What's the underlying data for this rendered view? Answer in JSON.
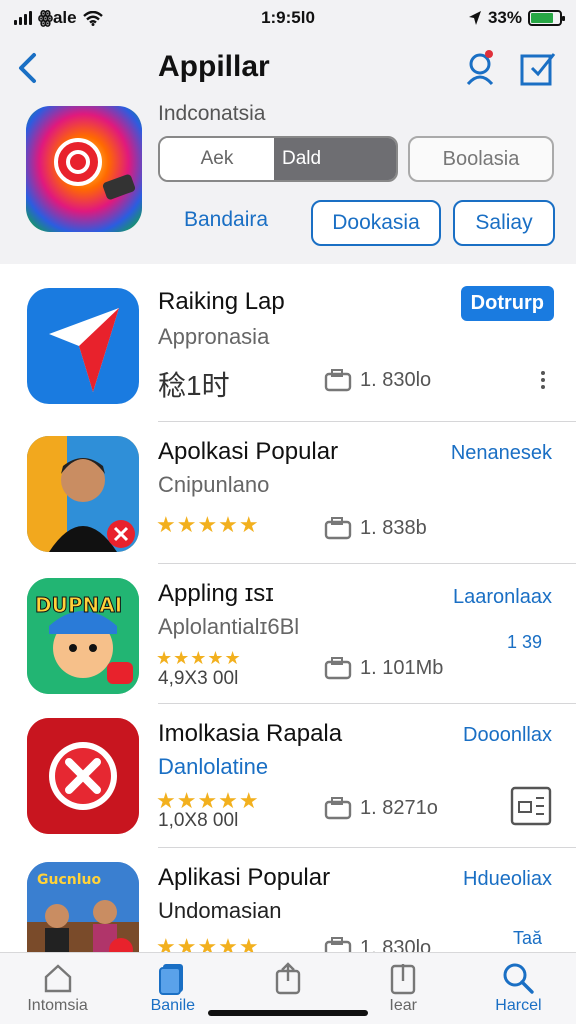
{
  "status": {
    "carrier": "ꙮale",
    "time": "1:9:5l0",
    "battery": "33%",
    "battery_level": 0.8
  },
  "header": {
    "title": "Appillar",
    "subtitle": "Indconatsia",
    "segment": {
      "left": "Aek",
      "right": "Dald"
    },
    "grey_button": "Boolasia",
    "chips": [
      "Bandaira",
      "Dookasia",
      "Saliay"
    ]
  },
  "apps": [
    {
      "name": "Raiking Lap",
      "sub": "Appronasia",
      "cjk": "稔1时",
      "size": "1. 830lo",
      "cta": "Dotrurp",
      "cta_style": "filled"
    },
    {
      "name": "Apolkasi Popular",
      "sub": "Cnipunlano",
      "stars": "★★★★★",
      "size": "1. 838b",
      "cta": "Nenanesek"
    },
    {
      "name": "Appling ɪsɪ",
      "sub": "Aplolantialɪ6Bl",
      "stars": "★★★★★",
      "rating": "4,9X3 00l",
      "size": "1. 101Mb",
      "cta": "Laaronlaax",
      "side": "1 39"
    },
    {
      "name": "Imolkasia Rapala",
      "sub": "Danlolatine",
      "stars": "★★★★★",
      "rating": "1,0X8 00l",
      "size": "1. 8271o",
      "cta": "Dooonllax"
    },
    {
      "name": "Aplikasi Popular",
      "sub": "Undomasian",
      "stars": "★★★★★",
      "size": "1. 830lo",
      "cta": "Hdueoliax",
      "side": "Taă"
    }
  ],
  "tabs": [
    {
      "label": "Intomsia",
      "icon": "home-icon"
    },
    {
      "label": "Banile",
      "icon": "apps-icon",
      "active": true
    },
    {
      "label": "",
      "icon": "share-icon"
    },
    {
      "label": "Iear",
      "icon": "download-icon"
    },
    {
      "label": "Harcel",
      "icon": "search-icon"
    }
  ]
}
